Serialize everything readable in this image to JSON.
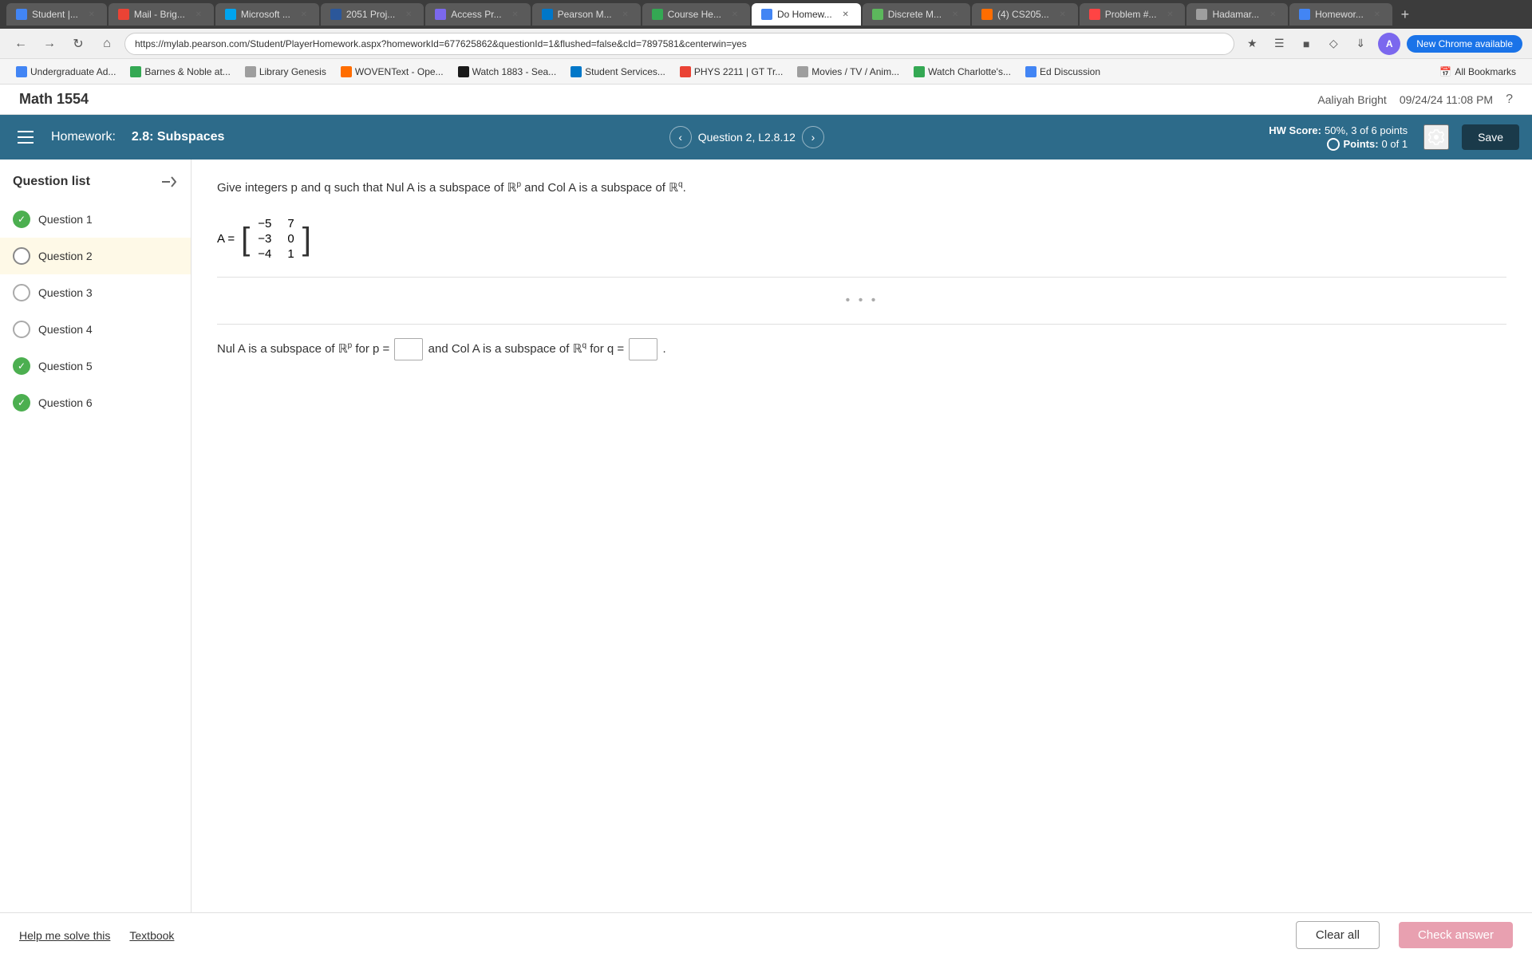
{
  "browser": {
    "tabs": [
      {
        "label": "Student |...",
        "active": false,
        "favicon_color": "#4285f4"
      },
      {
        "label": "Mail - Brig...",
        "active": false,
        "favicon_color": "#ea4335"
      },
      {
        "label": "Microsoft ...",
        "active": false,
        "favicon_color": "#00a4ef"
      },
      {
        "label": "2051 Proj...",
        "active": false,
        "favicon_color": "#2b579a"
      },
      {
        "label": "Access Pr...",
        "active": false,
        "favicon_color": "#7b68ee"
      },
      {
        "label": "Pearson M...",
        "active": false,
        "favicon_color": "#0077c8"
      },
      {
        "label": "Course He...",
        "active": false,
        "favicon_color": "#34a853"
      },
      {
        "label": "Do Homew...",
        "active": true,
        "favicon_color": "#4285f4"
      },
      {
        "label": "Discrete M...",
        "active": false,
        "favicon_color": "#5cb85c"
      },
      {
        "label": "(4) CS205...",
        "active": false,
        "favicon_color": "#ff6d00"
      },
      {
        "label": "Problem #...",
        "active": false,
        "favicon_color": "#ff4444"
      },
      {
        "label": "Hadamar...",
        "active": false,
        "favicon_color": "#9e9e9e"
      },
      {
        "label": "Homewor...",
        "active": false,
        "favicon_color": "#4285f4"
      }
    ],
    "address": "https://mylab.pearson.com/Student/PlayerHomework.aspx?homeworkId=677625862&questionId=1&flushed=false&cId=7897581&centerwin=yes",
    "new_chrome_label": "New Chrome available"
  },
  "bookmarks": [
    {
      "label": "Undergraduate Ad...",
      "favicon_color": "#4285f4"
    },
    {
      "label": "Barnes & Noble at...",
      "favicon_color": "#34a853"
    },
    {
      "label": "Library Genesis",
      "favicon_color": "#9e9e9e"
    },
    {
      "label": "WOVENText - Ope...",
      "favicon_color": "#ff6d00"
    },
    {
      "label": "Watch 1883 - Sea...",
      "favicon_color": "#1a1a1a"
    },
    {
      "label": "Student Services...",
      "favicon_color": "#0077c8"
    },
    {
      "label": "PHYS 2211 | GT Tr...",
      "favicon_color": "#ea4335"
    },
    {
      "label": "Movies / TV / Anim...",
      "favicon_color": "#9e9e9e"
    },
    {
      "label": "Watch Charlotte's...",
      "favicon_color": "#34a853"
    },
    {
      "label": "Ed Discussion",
      "favicon_color": "#4285f4"
    }
  ],
  "page_header": {
    "title": "Math 1554",
    "user": "Aaliyah Bright",
    "date": "09/24/24 11:08 PM"
  },
  "homework": {
    "title_prefix": "Homework:",
    "title": "2.8: Subspaces",
    "question_label": "Question 2, L2.8.12",
    "hw_score_label": "HW Score:",
    "hw_score_value": "50%, 3 of 6 points",
    "points_label": "Points:",
    "points_value": "0 of 1",
    "save_label": "Save"
  },
  "sidebar": {
    "title": "Question list",
    "questions": [
      {
        "label": "Question 1",
        "status": "correct"
      },
      {
        "label": "Question 2",
        "status": "current"
      },
      {
        "label": "Question 3",
        "status": "unanswered"
      },
      {
        "label": "Question 4",
        "status": "unanswered"
      },
      {
        "label": "Question 5",
        "status": "correct"
      },
      {
        "label": "Question 6",
        "status": "correct"
      }
    ]
  },
  "question": {
    "instruction": "Give integers p and q such that Nul A is a subspace of ℝ",
    "instruction_p": "p",
    "instruction_mid": "and Col A is a subspace of ℝ",
    "instruction_q": "q",
    "matrix_label": "A =",
    "matrix_rows": [
      [
        "-5",
        "7"
      ],
      [
        "-3",
        "0"
      ],
      [
        "-4",
        "1"
      ]
    ],
    "answer_prefix": "Nul A is a subspace of ℝ",
    "answer_p_sup": "p",
    "answer_for_p": "for p =",
    "answer_mid": "and Col A is a subspace of ℝ",
    "answer_q_sup": "q",
    "answer_for_q": "for q ="
  },
  "bottom_bar": {
    "help_link": "Help me solve this",
    "textbook_link": "Textbook",
    "clear_all_label": "Clear all",
    "check_answer_label": "Check answer"
  }
}
